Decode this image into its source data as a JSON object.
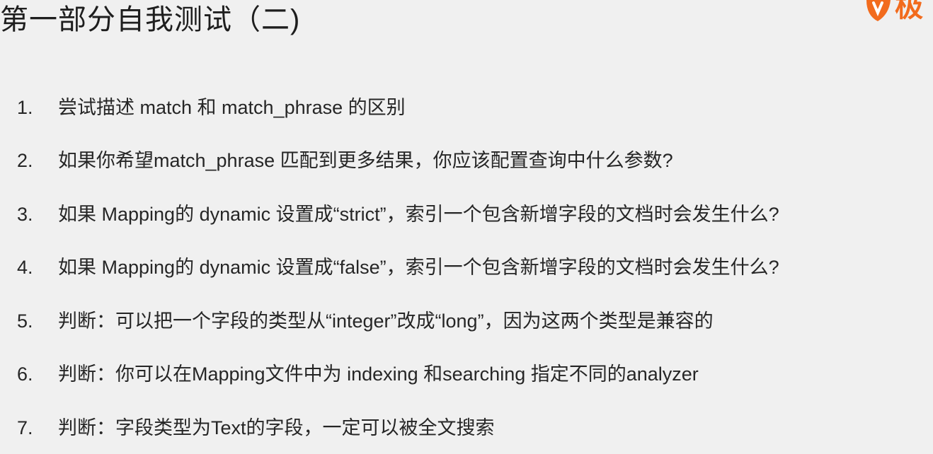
{
  "slide": {
    "title": "第一部分自我测试（二)",
    "logo_text": "极",
    "brand_color": "#f26b1d"
  },
  "questions": [
    {
      "num": "1.",
      "text": "尝试描述 match 和 match_phrase 的区别"
    },
    {
      "num": "2.",
      "text": "如果你希望match_phrase 匹配到更多结果，你应该配置查询中什么参数?"
    },
    {
      "num": "3.",
      "text": "如果 Mapping的 dynamic 设置成“strict”，索引一个包含新增字段的文档时会发生什么?"
    },
    {
      "num": "4.",
      "text": "如果 Mapping的 dynamic 设置成“false”，索引一个包含新增字段的文档时会发生什么?"
    },
    {
      "num": "5.",
      "text": "判断：可以把一个字段的类型从“integer”改成“long”，因为这两个类型是兼容的"
    },
    {
      "num": "6.",
      "text": "判断：你可以在Mapping文件中为 indexing 和searching 指定不同的analyzer"
    },
    {
      "num": "7.",
      "text": "判断：字段类型为Text的字段，一定可以被全文搜索"
    }
  ]
}
